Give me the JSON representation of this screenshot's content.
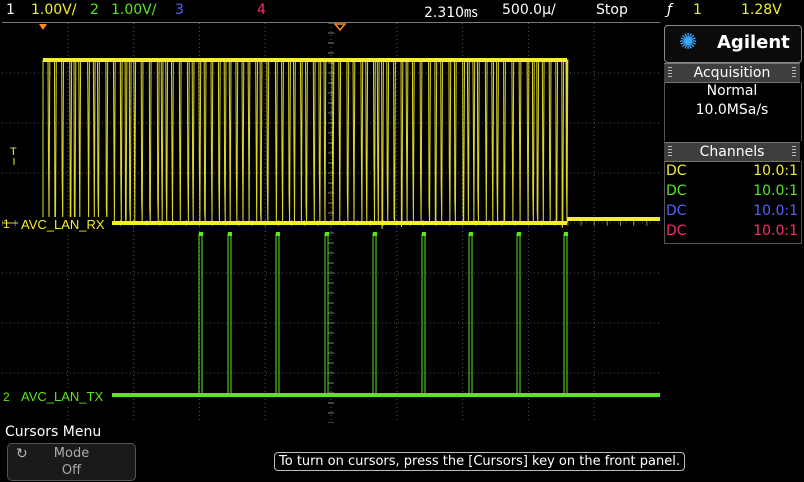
{
  "status_bar": {
    "ch1_num": "1",
    "ch1_scale": "1.00V/",
    "ch2_num": "2",
    "ch2_scale": "1.00V/",
    "ch3_num": "3",
    "ch4_num": "4",
    "delay": "2.310㎳",
    "timebase": "500.0µ/",
    "run_state": "Stop",
    "trigger_icon": "ƒ",
    "trigger_source": "1",
    "trigger_level": "1.28V"
  },
  "plot": {
    "trace1_label": "AVC_LAN_RX",
    "trace2_label": "AVC_LAN_TX",
    "trace1_marker": "1",
    "trace2_marker": "2",
    "trigger_marker": "T"
  },
  "panel": {
    "brand": "Agilent",
    "acquisition": {
      "title": "Acquisition",
      "mode": "Normal",
      "rate": "10.0MSa/s"
    },
    "channels": {
      "title": "Channels",
      "rows": [
        {
          "coupling": "DC",
          "probe": "10.0:1",
          "color": "#f5ee2d"
        },
        {
          "coupling": "DC",
          "probe": "10.0:1",
          "color": "#58e81f"
        },
        {
          "coupling": "DC",
          "probe": "10.0:1",
          "color": "#4f64ff"
        },
        {
          "coupling": "DC",
          "probe": "10.0:1",
          "color": "#ff2a6a"
        }
      ]
    }
  },
  "menu": {
    "title": "Cursors Menu",
    "softkey_label": "Mode",
    "softkey_value": "Off",
    "hint": "To turn on cursors, press the [Cursors] key on the front panel."
  },
  "colors": {
    "ch1": "#f5ee2d",
    "ch2": "#58e81f",
    "ch3": "#4f64ff",
    "ch4": "#ff2a6a",
    "grid": "#5a5a5a"
  }
}
